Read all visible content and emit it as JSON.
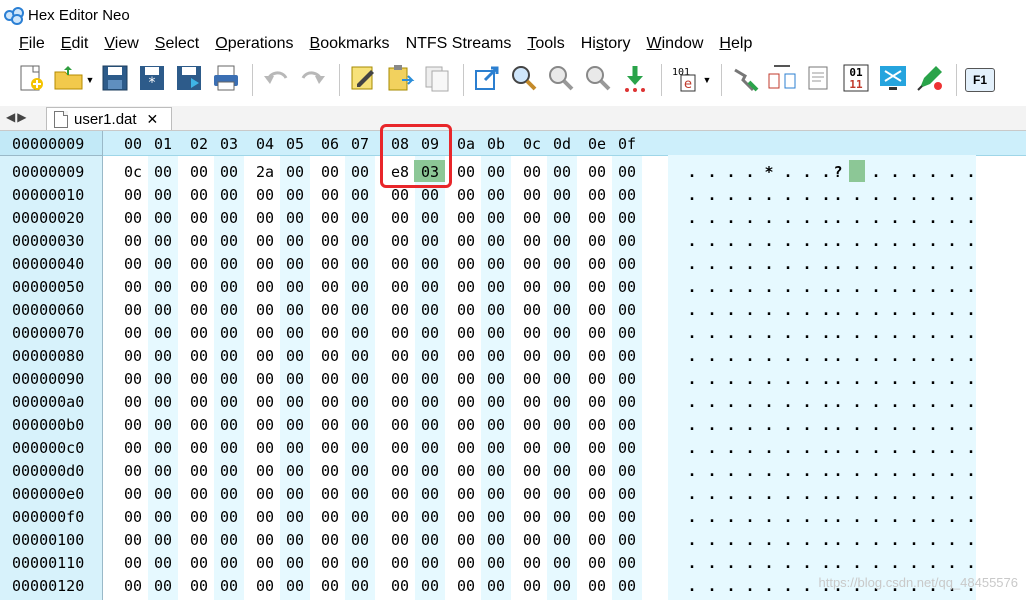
{
  "window": {
    "title": "Hex Editor Neo"
  },
  "menu": [
    {
      "pre": "",
      "key": "F",
      "post": "ile",
      "name": "menu-file"
    },
    {
      "pre": "",
      "key": "E",
      "post": "dit",
      "name": "menu-edit"
    },
    {
      "pre": "",
      "key": "V",
      "post": "iew",
      "name": "menu-view"
    },
    {
      "pre": "",
      "key": "S",
      "post": "elect",
      "name": "menu-select"
    },
    {
      "pre": "",
      "key": "O",
      "post": "perations",
      "name": "menu-operations"
    },
    {
      "pre": "",
      "key": "B",
      "post": "ookmarks",
      "name": "menu-bookmarks"
    },
    {
      "pre": "NTFS Streams",
      "key": "",
      "post": "",
      "name": "menu-ntfs-streams"
    },
    {
      "pre": "",
      "key": "T",
      "post": "ools",
      "name": "menu-tools"
    },
    {
      "pre": "Hi",
      "key": "s",
      "post": "tory",
      "name": "menu-history"
    },
    {
      "pre": "",
      "key": "W",
      "post": "indow",
      "name": "menu-window"
    },
    {
      "pre": "",
      "key": "H",
      "post": "elp",
      "name": "menu-help"
    }
  ],
  "toolbar": [
    {
      "icon": "new-file-icon"
    },
    {
      "icon": "open-folder-icon",
      "dropdown": true
    },
    {
      "icon": "save-icon"
    },
    {
      "icon": "save-modified-icon"
    },
    {
      "icon": "save-as-icon"
    },
    {
      "icon": "print-icon"
    },
    {
      "sep": true
    },
    {
      "icon": "undo-icon"
    },
    {
      "icon": "redo-icon"
    },
    {
      "sep": true
    },
    {
      "icon": "edit-icon"
    },
    {
      "icon": "paste-icon"
    },
    {
      "icon": "copy-icon"
    },
    {
      "sep": true
    },
    {
      "icon": "export-icon"
    },
    {
      "icon": "find-icon"
    },
    {
      "icon": "find-next-icon"
    },
    {
      "icon": "find-prev-icon"
    },
    {
      "icon": "download-arrow-icon"
    },
    {
      "sep": true
    },
    {
      "icon": "hex-data-icon",
      "dropdown": true
    },
    {
      "sep": true
    },
    {
      "icon": "inspect-icon"
    },
    {
      "icon": "compare-icon"
    },
    {
      "icon": "text-mode-icon"
    },
    {
      "icon": "binary-icon"
    },
    {
      "icon": "fullscreen-icon"
    },
    {
      "icon": "pen-check-icon"
    },
    {
      "sep": true
    },
    {
      "icon": "help-f1-icon",
      "label": "F1"
    }
  ],
  "tabs": {
    "nav": "◀▶",
    "file": "user1.dat",
    "close": "✕"
  },
  "editor": {
    "header_offset": "00000009",
    "columns": [
      "00",
      "01",
      "02",
      "03",
      "04",
      "05",
      "06",
      "07",
      "08",
      "09",
      "0a",
      "0b",
      "0c",
      "0d",
      "0e",
      "0f"
    ],
    "rows": [
      {
        "addr": "00000009",
        "bytes": [
          "0c",
          "00",
          "00",
          "00",
          "2a",
          "00",
          "00",
          "00",
          "e8",
          "03",
          "00",
          "00",
          "00",
          "00",
          "00",
          "00"
        ],
        "ascii": [
          ".",
          ".",
          ".",
          ".",
          "*",
          ".",
          ".",
          ".",
          "?",
          "",
          ".",
          ".",
          ".",
          ".",
          ".",
          "."
        ]
      },
      {
        "addr": "00000010",
        "bytes": [
          "00",
          "00",
          "00",
          "00",
          "00",
          "00",
          "00",
          "00",
          "00",
          "00",
          "00",
          "00",
          "00",
          "00",
          "00",
          "00"
        ]
      },
      {
        "addr": "00000020",
        "bytes": [
          "00",
          "00",
          "00",
          "00",
          "00",
          "00",
          "00",
          "00",
          "00",
          "00",
          "00",
          "00",
          "00",
          "00",
          "00",
          "00"
        ]
      },
      {
        "addr": "00000030",
        "bytes": [
          "00",
          "00",
          "00",
          "00",
          "00",
          "00",
          "00",
          "00",
          "00",
          "00",
          "00",
          "00",
          "00",
          "00",
          "00",
          "00"
        ]
      },
      {
        "addr": "00000040",
        "bytes": [
          "00",
          "00",
          "00",
          "00",
          "00",
          "00",
          "00",
          "00",
          "00",
          "00",
          "00",
          "00",
          "00",
          "00",
          "00",
          "00"
        ]
      },
      {
        "addr": "00000050",
        "bytes": [
          "00",
          "00",
          "00",
          "00",
          "00",
          "00",
          "00",
          "00",
          "00",
          "00",
          "00",
          "00",
          "00",
          "00",
          "00",
          "00"
        ]
      },
      {
        "addr": "00000060",
        "bytes": [
          "00",
          "00",
          "00",
          "00",
          "00",
          "00",
          "00",
          "00",
          "00",
          "00",
          "00",
          "00",
          "00",
          "00",
          "00",
          "00"
        ]
      },
      {
        "addr": "00000070",
        "bytes": [
          "00",
          "00",
          "00",
          "00",
          "00",
          "00",
          "00",
          "00",
          "00",
          "00",
          "00",
          "00",
          "00",
          "00",
          "00",
          "00"
        ]
      },
      {
        "addr": "00000080",
        "bytes": [
          "00",
          "00",
          "00",
          "00",
          "00",
          "00",
          "00",
          "00",
          "00",
          "00",
          "00",
          "00",
          "00",
          "00",
          "00",
          "00"
        ]
      },
      {
        "addr": "00000090",
        "bytes": [
          "00",
          "00",
          "00",
          "00",
          "00",
          "00",
          "00",
          "00",
          "00",
          "00",
          "00",
          "00",
          "00",
          "00",
          "00",
          "00"
        ]
      },
      {
        "addr": "000000a0",
        "bytes": [
          "00",
          "00",
          "00",
          "00",
          "00",
          "00",
          "00",
          "00",
          "00",
          "00",
          "00",
          "00",
          "00",
          "00",
          "00",
          "00"
        ]
      },
      {
        "addr": "000000b0",
        "bytes": [
          "00",
          "00",
          "00",
          "00",
          "00",
          "00",
          "00",
          "00",
          "00",
          "00",
          "00",
          "00",
          "00",
          "00",
          "00",
          "00"
        ]
      },
      {
        "addr": "000000c0",
        "bytes": [
          "00",
          "00",
          "00",
          "00",
          "00",
          "00",
          "00",
          "00",
          "00",
          "00",
          "00",
          "00",
          "00",
          "00",
          "00",
          "00"
        ]
      },
      {
        "addr": "000000d0",
        "bytes": [
          "00",
          "00",
          "00",
          "00",
          "00",
          "00",
          "00",
          "00",
          "00",
          "00",
          "00",
          "00",
          "00",
          "00",
          "00",
          "00"
        ]
      },
      {
        "addr": "000000e0",
        "bytes": [
          "00",
          "00",
          "00",
          "00",
          "00",
          "00",
          "00",
          "00",
          "00",
          "00",
          "00",
          "00",
          "00",
          "00",
          "00",
          "00"
        ]
      },
      {
        "addr": "000000f0",
        "bytes": [
          "00",
          "00",
          "00",
          "00",
          "00",
          "00",
          "00",
          "00",
          "00",
          "00",
          "00",
          "00",
          "00",
          "00",
          "00",
          "00"
        ]
      },
      {
        "addr": "00000100",
        "bytes": [
          "00",
          "00",
          "00",
          "00",
          "00",
          "00",
          "00",
          "00",
          "00",
          "00",
          "00",
          "00",
          "00",
          "00",
          "00",
          "00"
        ]
      },
      {
        "addr": "00000110",
        "bytes": [
          "00",
          "00",
          "00",
          "00",
          "00",
          "00",
          "00",
          "00",
          "00",
          "00",
          "00",
          "00",
          "00",
          "00",
          "00",
          "00"
        ]
      },
      {
        "addr": "00000120",
        "bytes": [
          "00",
          "00",
          "00",
          "00",
          "00",
          "00",
          "00",
          "00",
          "00",
          "00",
          "00",
          "00",
          "00",
          "00",
          "00",
          "00"
        ]
      }
    ],
    "selected_byte": {
      "row": 0,
      "column": "09",
      "value": "03"
    },
    "highlight_color": "#8cc796",
    "annotation_color": "#e8262a"
  },
  "watermark": "https://blog.csdn.net/qq_48455576"
}
